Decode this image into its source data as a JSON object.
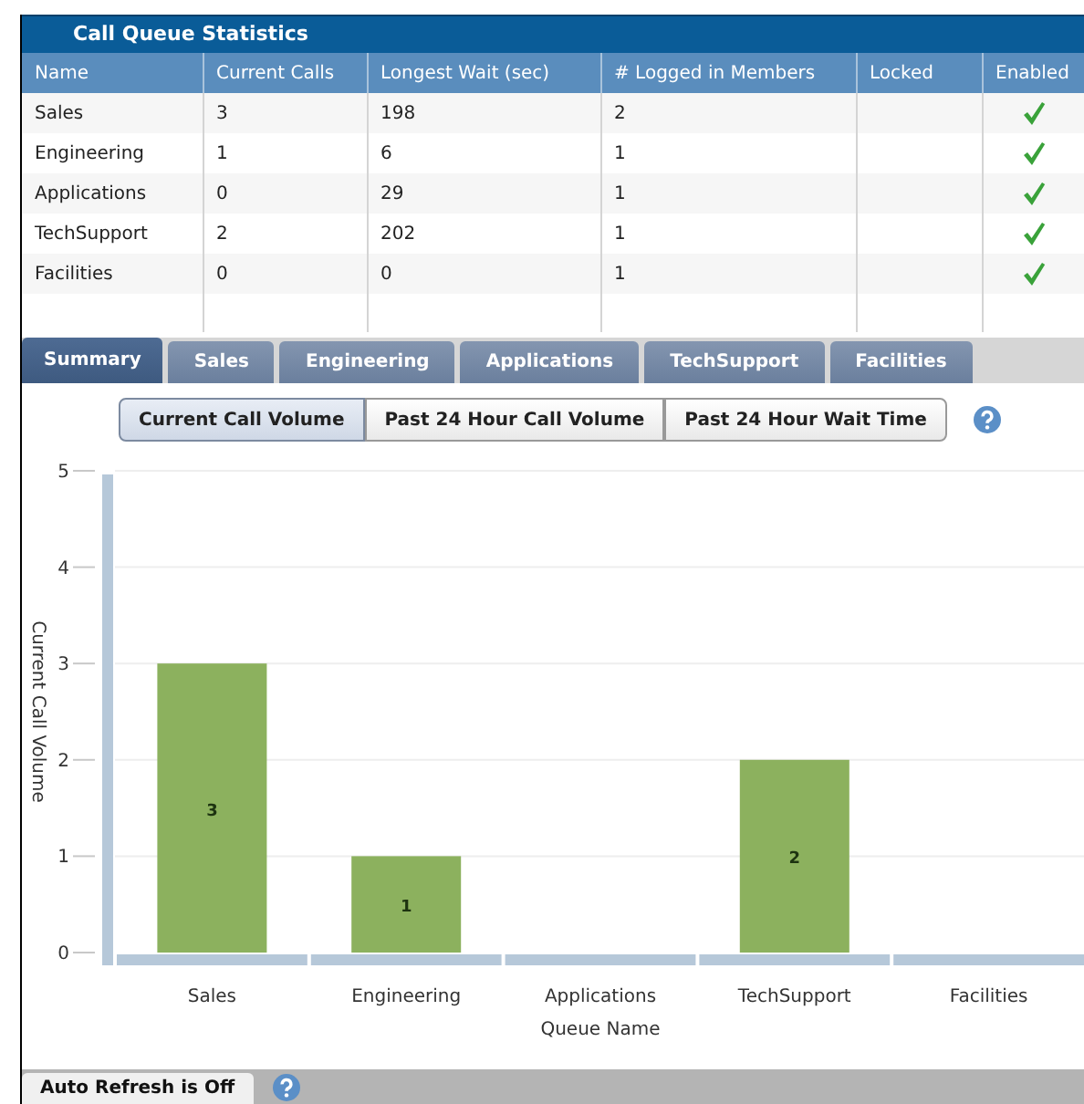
{
  "panel": {
    "title": "Call Queue Statistics"
  },
  "table": {
    "columns": [
      "Name",
      "Current Calls",
      "Longest Wait (sec)",
      "# Logged in Members",
      "Locked",
      "Enabled"
    ],
    "rows": [
      {
        "name": "Sales",
        "current_calls": "3",
        "longest_wait": "198",
        "logged_in": "2",
        "enabled": true
      },
      {
        "name": "Engineering",
        "current_calls": "1",
        "longest_wait": "6",
        "logged_in": "1",
        "enabled": true
      },
      {
        "name": "Applications",
        "current_calls": "0",
        "longest_wait": "29",
        "logged_in": "1",
        "enabled": true
      },
      {
        "name": "TechSupport",
        "current_calls": "2",
        "longest_wait": "202",
        "logged_in": "1",
        "enabled": true
      },
      {
        "name": "Facilities",
        "current_calls": "0",
        "longest_wait": "0",
        "logged_in": "1",
        "enabled": true
      }
    ]
  },
  "tabs": [
    {
      "label": "Summary",
      "selected": true
    },
    {
      "label": "Sales",
      "selected": false
    },
    {
      "label": "Engineering",
      "selected": false
    },
    {
      "label": "Applications",
      "selected": false
    },
    {
      "label": "TechSupport",
      "selected": false
    },
    {
      "label": "Facilities",
      "selected": false
    }
  ],
  "chart_buttons": [
    {
      "label": "Current Call Volume",
      "selected": true
    },
    {
      "label": "Past 24 Hour Call Volume",
      "selected": false
    },
    {
      "label": "Past 24 Hour Wait Time",
      "selected": false
    }
  ],
  "chart": {
    "chart_data": {
      "type": "bar",
      "xlabel": "Queue Name",
      "ylabel": "Current Call Volume",
      "categories": [
        "Sales",
        "Engineering",
        "Applications",
        "TechSupport",
        "Facilities"
      ],
      "values": [
        3,
        1,
        0,
        2,
        0
      ],
      "ylim": [
        0,
        5
      ],
      "yticks": [
        0,
        1,
        2,
        3,
        4,
        5
      ],
      "grid": true,
      "value_labels": [
        "3",
        "1",
        null,
        "2",
        null
      ]
    }
  },
  "status_bar": {
    "auto_refresh": "Auto Refresh is Off"
  }
}
